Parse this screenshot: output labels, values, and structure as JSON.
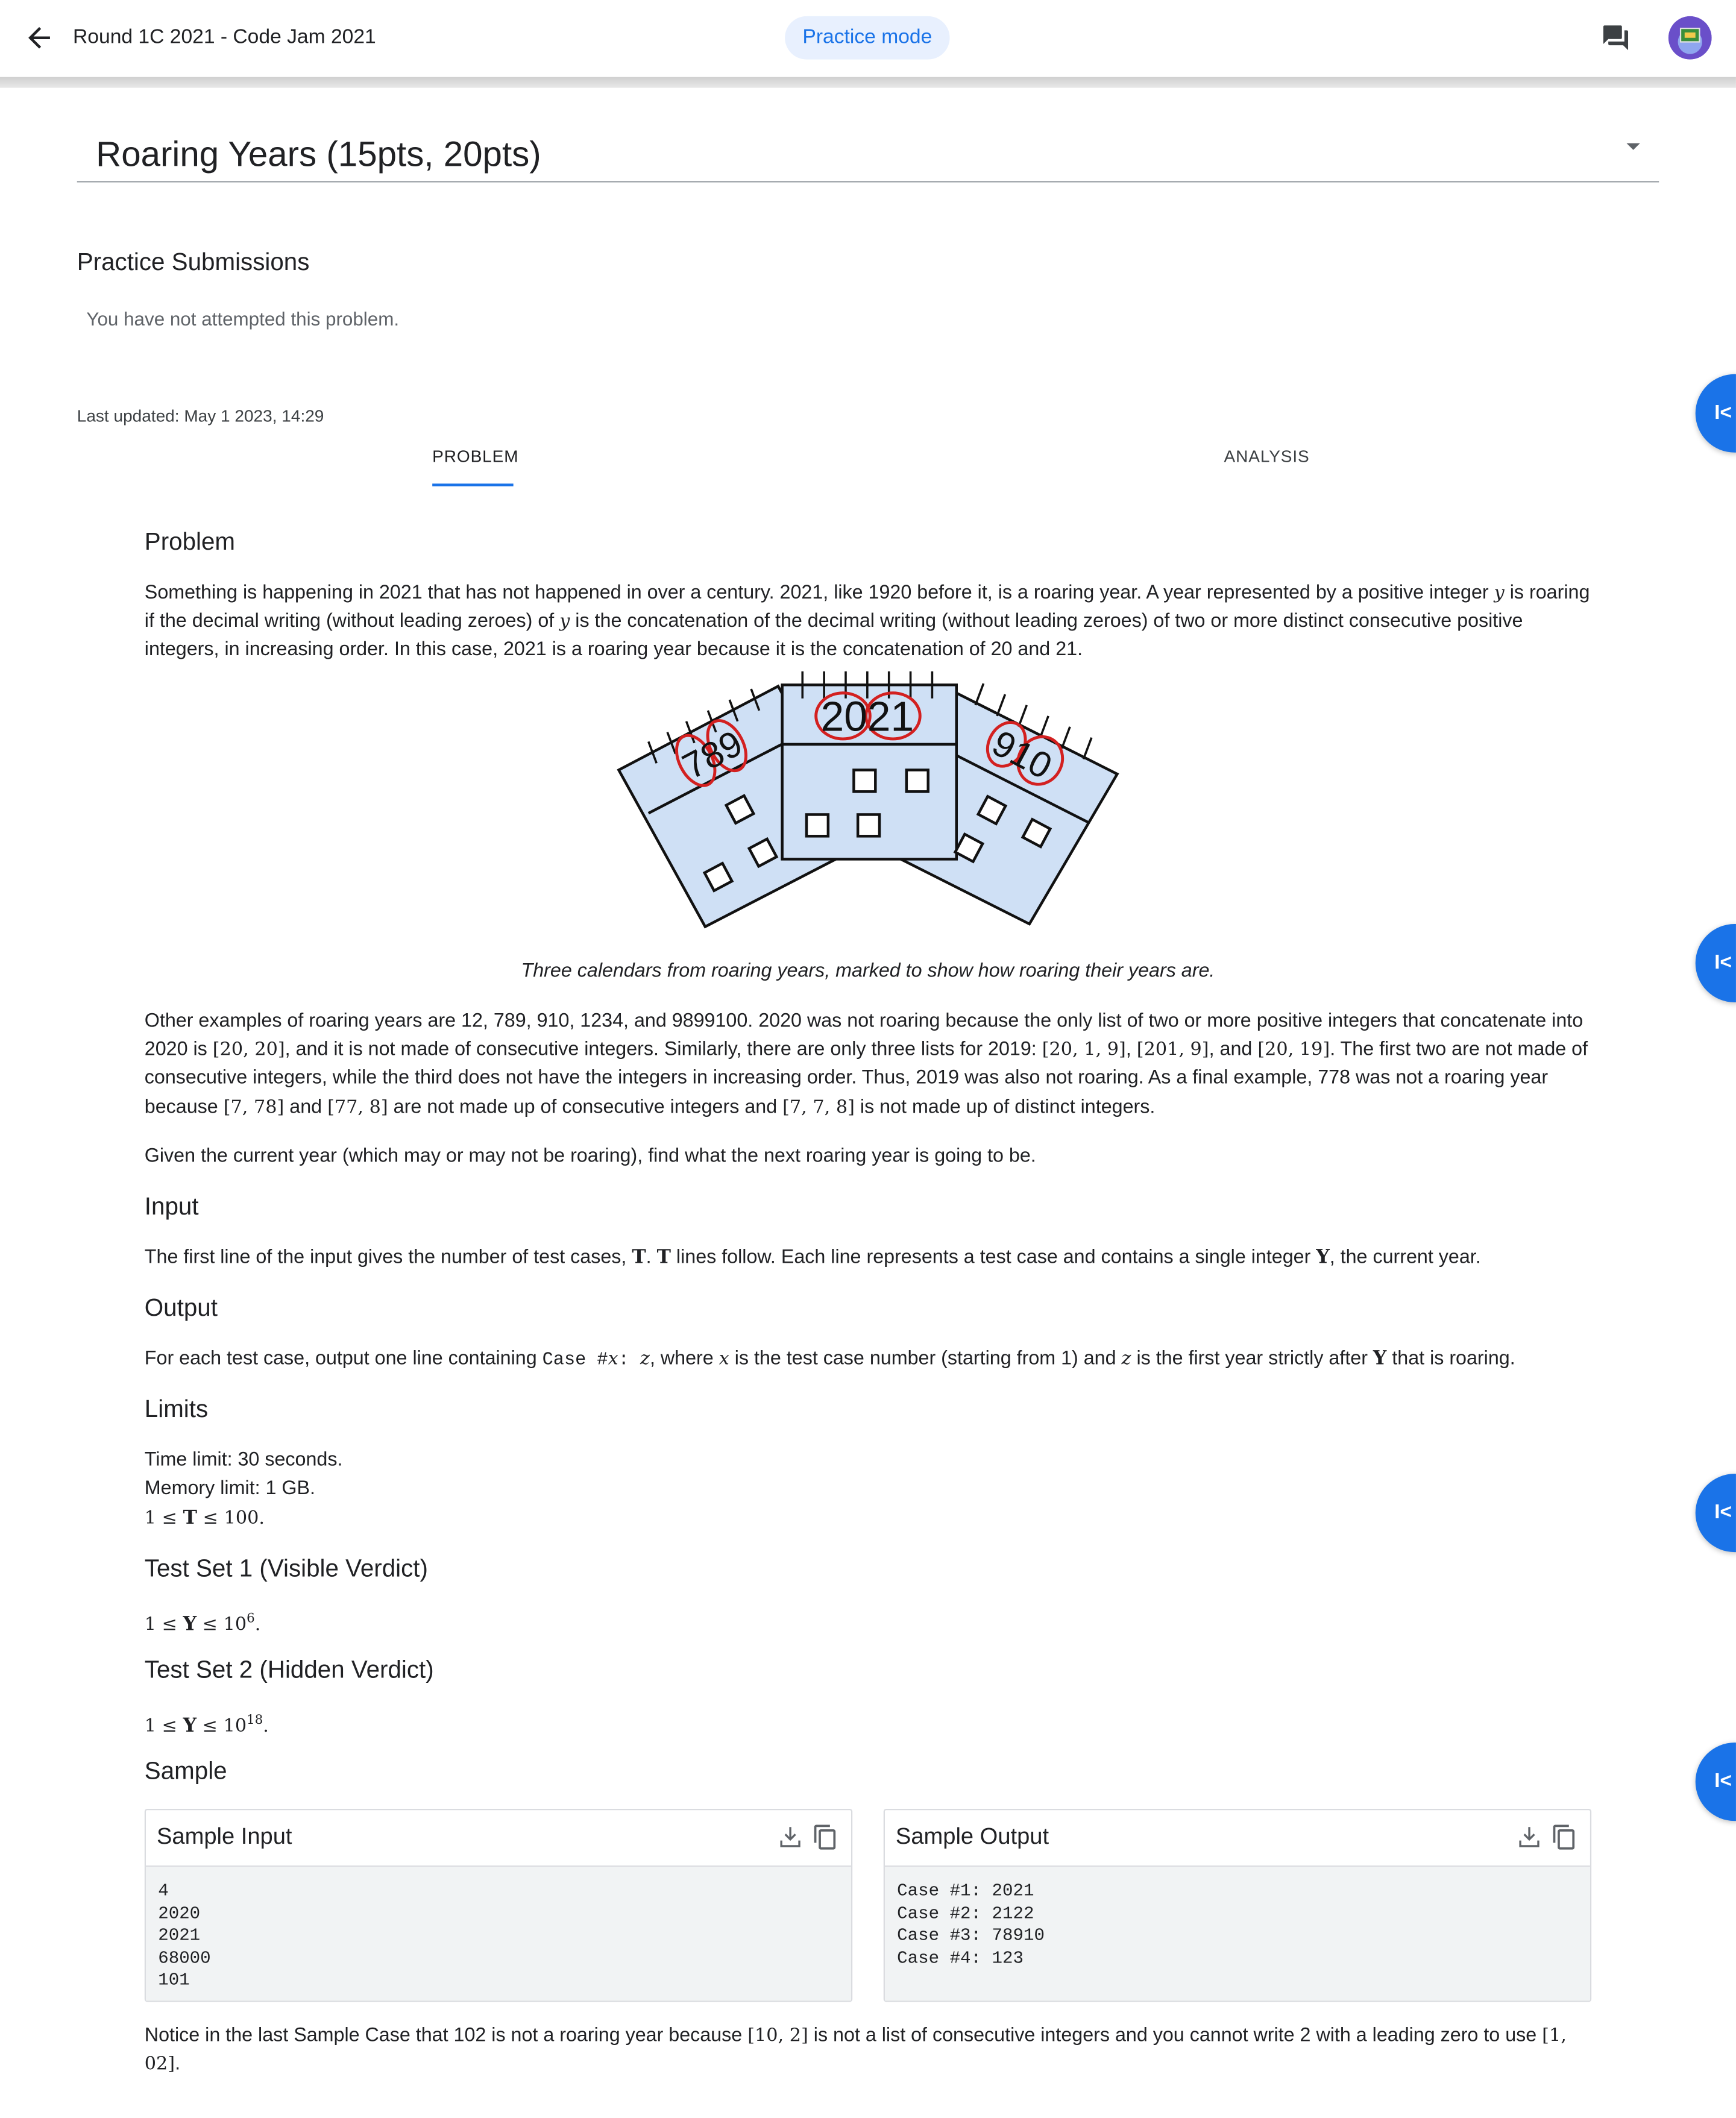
{
  "header": {
    "title": "Round 1C 2021 - Code Jam 2021",
    "mode_chip": "Practice mode"
  },
  "problem_select": {
    "title": "Roaring Years (15pts, 20pts)"
  },
  "practice": {
    "heading": "Practice Submissions",
    "status": "You have not attempted this problem."
  },
  "last_updated": "Last updated: May 1 2023, 14:29",
  "tabs": [
    "PROBLEM",
    "ANALYSIS"
  ],
  "fab_label": "I<",
  "figure": {
    "labels": [
      "789",
      "2021",
      "910"
    ],
    "caption": "Three calendars from roaring years, marked to show how roaring their years are."
  },
  "sections": {
    "problem": "Problem",
    "input": "Input",
    "output": "Output",
    "limits": "Limits",
    "ts1": "Test Set 1 (Visible Verdict)",
    "ts2": "Test Set 2 (Hidden Verdict)",
    "sample": "Sample"
  },
  "text": {
    "p1a": "Something is happening in 2021 that has not happened in over a century. 2021, like 1920 before it, is a roaring year. A year represented by a positive integer ",
    "p1_var": "y",
    "p1b": " is roaring if the decimal writing (without leading zeroes) of ",
    "p1c": " is the concatenation of the decimal writing (without leading zeroes) of two or more distinct consecutive positive integers, in increasing order. In this case, 2021 is a roaring year because it is the concatenation of 20 and 21.",
    "p2a": "Other examples of roaring years are 12, 789, 910, 1234, and 9899100. 2020 was not roaring because the only list of two or more positive integers that concatenate into 2020 is ",
    "p2_l1": "[20, 20]",
    "p2b": ", and it is not made of consecutive integers. Similarly, there are only three lists for 2019: ",
    "p2_l2": "[20, 1, 9]",
    "p2_sep1": ", ",
    "p2_l3": "[201, 9]",
    "p2_sep2": ", and ",
    "p2_l4": "[20, 19]",
    "p2c": ". The first two are not made of consecutive integers, while the third does not have the integers in increasing order. Thus, 2019 was also not roaring. As a final example, 778 was not a roaring year because ",
    "p2_l5": "[7, 78]",
    "p2_and": " and ",
    "p2_l6": "[77, 8]",
    "p2d": " are not made up of consecutive integers and ",
    "p2_l7": "[7, 7, 8]",
    "p2e": " is not made up of distinct integers.",
    "p3": "Given the current year (which may or may not be roaring), find what the next roaring year is going to be.",
    "in_a": "The first line of the input gives the number of test cases, ",
    "in_T": "T",
    "in_b": ". ",
    "in_c": " lines follow. Each line represents a test case and contains a single integer ",
    "in_Y": "Y",
    "in_d": ", the current year.",
    "out_a": "For each test case, output one line containing ",
    "out_case": "Case #",
    "out_x": "x",
    "out_colon": ": ",
    "out_z": "z",
    "out_b": ", where ",
    "out_c": " is the test case number (starting from 1) and ",
    "out_d": " is the first year strictly after ",
    "out_Y": "Y",
    "out_e": " that is roaring.",
    "lim_time": "Time limit: 30 seconds.",
    "lim_mem": "Memory limit: 1 GB.",
    "lim_t_a": "1 ≤ ",
    "lim_t_var": "T",
    "lim_t_b": " ≤ 100.",
    "ts1_a": "1 ≤ ",
    "ts1_var": "Y",
    "ts1_b": " ≤ 10",
    "ts1_exp": "6",
    "ts1_c": ".",
    "ts2_a": "1 ≤ ",
    "ts2_var": "Y",
    "ts2_b": " ≤ 10",
    "ts2_exp": "18",
    "ts2_c": ".",
    "note_a": "Notice in the last Sample Case that 102 is not a roaring year because ",
    "note_l1": "[10, 2]",
    "note_b": " is not a list of consecutive integers and you cannot write 2 with a leading zero to use ",
    "note_l2": "[1, 02]",
    "note_c": "."
  },
  "sample": {
    "input_title": "Sample Input",
    "output_title": "Sample Output",
    "input": "4\n2020\n2021\n68000\n101",
    "output": "Case #1: 2021\nCase #2: 2122\nCase #3: 78910\nCase #4: 123"
  }
}
